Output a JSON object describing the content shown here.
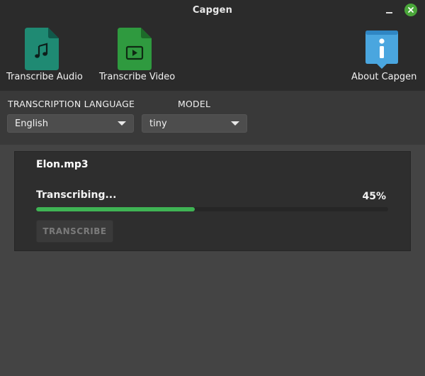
{
  "window": {
    "title": "Capgen",
    "accent_close": "#4aa63a"
  },
  "toolbar": {
    "transcribe_audio_label": "Transcribe Audio",
    "transcribe_video_label": "Transcribe Video",
    "about_label": "About Capgen",
    "audio_icon_color": "#1f8a73",
    "video_icon_color": "#2f9a3f",
    "about_icon_color": "#4aa6df"
  },
  "controls": {
    "language_label": "TRANSCRIPTION LANGUAGE",
    "language_value": "English",
    "model_label": "MODEL",
    "model_value": "tiny"
  },
  "job": {
    "filename": "Elon.mp3",
    "status": "Transcribing...",
    "percent_text": "45%",
    "progress": 0.45,
    "button_label": "TRANSCRIBE",
    "progress_color": "#3fb454"
  }
}
